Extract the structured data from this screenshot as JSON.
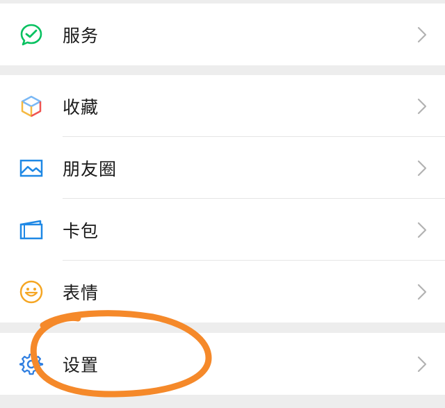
{
  "groups": [
    {
      "items": [
        {
          "label": "服务",
          "icon": "services-check-bubble-icon"
        }
      ]
    },
    {
      "items": [
        {
          "label": "收藏",
          "icon": "favorites-cube-icon"
        },
        {
          "label": "朋友圈",
          "icon": "moments-picture-icon"
        },
        {
          "label": "卡包",
          "icon": "card-wallet-icon"
        },
        {
          "label": "表情",
          "icon": "stickers-smiley-icon"
        }
      ]
    },
    {
      "items": [
        {
          "label": "设置",
          "icon": "settings-gear-icon"
        }
      ]
    }
  ],
  "colors": {
    "background": "#ededed",
    "row": "#ffffff",
    "services_icon": "#07c160",
    "moments_icon": "#1e88e5",
    "card_icon": "#1e88e5",
    "stickers_icon": "#f5a623",
    "settings_icon": "#2f7ee0",
    "chevron": "#b2b2b2",
    "annotation": "#f5892a"
  }
}
